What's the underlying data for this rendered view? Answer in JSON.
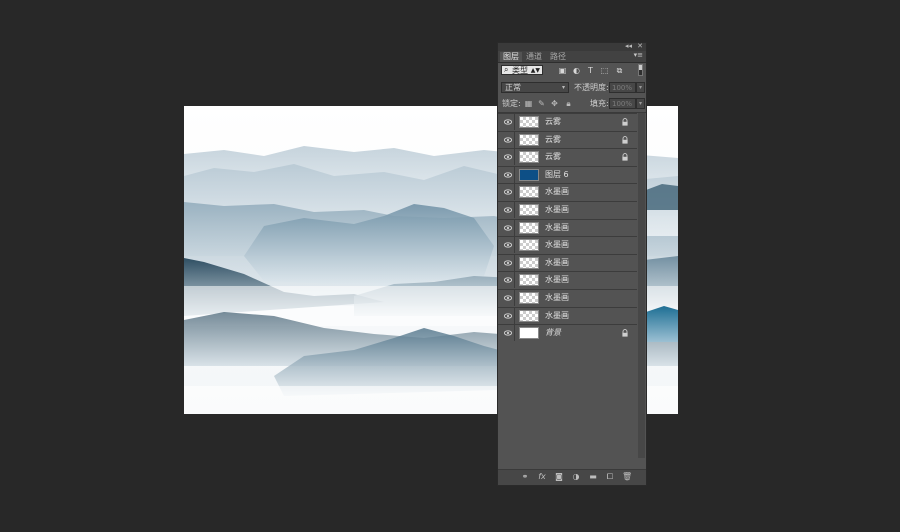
{
  "panel": {
    "tabs": [
      "图层",
      "通道",
      "路径"
    ],
    "collapse_glyph": "◂◂",
    "close_glyph": "✕",
    "menu_glyph": "▾≡",
    "filter": {
      "glyph": "⌕",
      "label": "类型",
      "arrow": "▲▼"
    },
    "filter_icons": [
      "image-filter-icon",
      "adjustment-filter-icon",
      "type-filter-icon",
      "shape-filter-icon",
      "smart-object-filter-icon"
    ],
    "blend_mode": "正常",
    "opacity_label": "不透明度:",
    "opacity_value": "100%",
    "lock_label": "锁定:",
    "fill_label": "填充:",
    "fill_value": "100%",
    "dropdown_arrow": "▾"
  },
  "layers": [
    {
      "name": "云雾",
      "locked": true,
      "thumb": "transparent"
    },
    {
      "name": "云雾",
      "locked": true,
      "thumb": "transparent"
    },
    {
      "name": "云雾",
      "locked": true,
      "thumb": "transparent"
    },
    {
      "name": "图层 6",
      "locked": false,
      "thumb": "#0d4f86"
    },
    {
      "name": "水墨画",
      "locked": false,
      "thumb": "transparent"
    },
    {
      "name": "水墨画",
      "locked": false,
      "thumb": "transparent"
    },
    {
      "name": "水墨画",
      "locked": false,
      "thumb": "transparent"
    },
    {
      "name": "水墨画",
      "locked": false,
      "thumb": "transparent"
    },
    {
      "name": "水墨画",
      "locked": false,
      "thumb": "transparent"
    },
    {
      "name": "水墨画",
      "locked": false,
      "thumb": "transparent"
    },
    {
      "name": "水墨画",
      "locked": false,
      "thumb": "transparent"
    },
    {
      "name": "水墨画",
      "locked": false,
      "thumb": "transparent"
    },
    {
      "name": "背景",
      "locked": true,
      "thumb": "#ffffff",
      "italic": true
    }
  ],
  "bottom_icons": [
    "link-layers-icon",
    "fx-icon",
    "mask-icon",
    "adjustment-layer-icon",
    "folder-icon",
    "new-layer-icon",
    "trash-icon"
  ],
  "colors": {
    "app_bg": "#282828",
    "panel_bg": "#535353",
    "layer_blue": "#0d4f86"
  }
}
